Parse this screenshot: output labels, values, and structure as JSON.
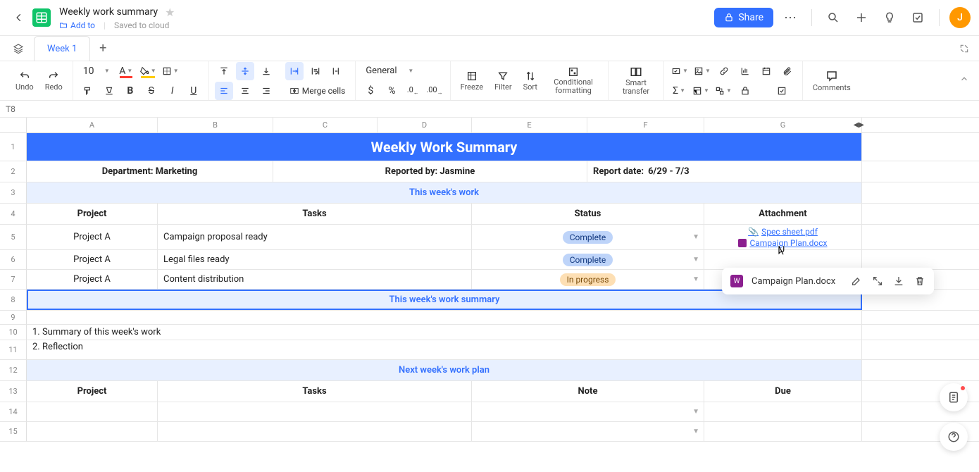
{
  "header": {
    "doc_title": "Weekly work summary",
    "add_to": "Add to",
    "saved": "Saved to cloud",
    "share": "Share",
    "avatar_letter": "J"
  },
  "tabs": {
    "active": "Week 1"
  },
  "name_box": "T8",
  "toolbar": {
    "undo": "Undo",
    "redo": "Redo",
    "font_size": "10",
    "merge": "Merge cells",
    "num_format": "General",
    "freeze": "Freeze",
    "filter": "Filter",
    "sort": "Sort",
    "cond_fmt": "Conditional formatting",
    "smart": "Smart transfer",
    "comments": "Comments"
  },
  "columns": [
    "A",
    "B",
    "C",
    "D",
    "E",
    "F",
    "G"
  ],
  "row_numbers": [
    "1",
    "2",
    "3",
    "4",
    "5",
    "6",
    "7",
    "8",
    "9",
    "10",
    "11",
    "12",
    "13",
    "14",
    "15"
  ],
  "sheet": {
    "title": "Weekly Work Summary",
    "dept": "Department: Marketing",
    "reporter": "Reported by: Jasmine",
    "report_date_lbl": "Report date:",
    "report_date_val": "6/29 - 7/3",
    "section_this_week": "This week's work",
    "hdr_project": "Project",
    "hdr_tasks": "Tasks",
    "hdr_status": "Status",
    "hdr_attachment": "Attachment",
    "rows": [
      {
        "project": "Project A",
        "task": "Campaign proposal ready",
        "status": "Complete",
        "status_class": "pill-complete",
        "att1": "Spec sheet.pdf",
        "att2": "Campaign Plan.docx"
      },
      {
        "project": "Project A",
        "task": "Legal files ready",
        "status": "Complete",
        "status_class": "pill-complete"
      },
      {
        "project": "Project A",
        "task": "Content distribution",
        "status": "In progress",
        "status_class": "pill-progress"
      }
    ],
    "section_summary": "This week's work summary",
    "summary_1": "1. Summary of this week's work",
    "summary_2": "2. Reflection",
    "section_next": "Next week's work plan",
    "hdr_note": "Note",
    "hdr_due": "Due"
  },
  "popup": {
    "filename": "Campaign Plan.docx"
  }
}
